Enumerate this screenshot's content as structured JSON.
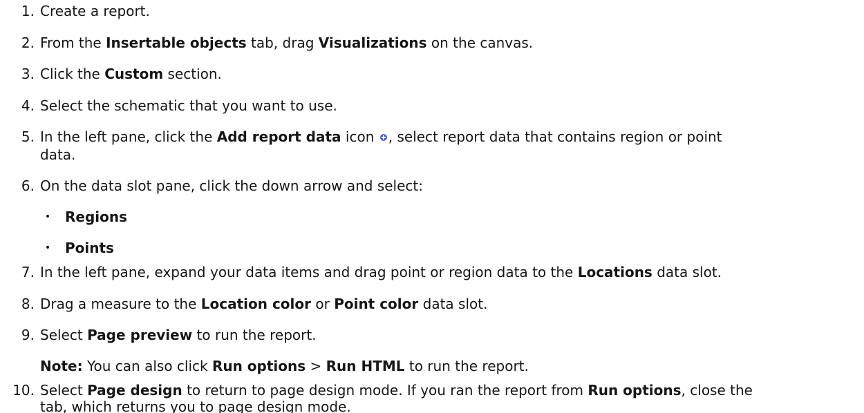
{
  "steps": {
    "s1": {
      "num": "1.",
      "text": "Create a report."
    },
    "s2": {
      "num": "2.",
      "a": "From the ",
      "b": "Insertable objects",
      "c": " tab, drag ",
      "d": "Visualizations",
      "e": " on the canvas."
    },
    "s3": {
      "num": "3.",
      "a": "Click the ",
      "b": "Custom",
      "c": " section."
    },
    "s4": {
      "num": "4.",
      "text": "Select the schematic that you want to use."
    },
    "s5": {
      "num": "5.",
      "a": "In the left pane, click the ",
      "b": "Add report data",
      "c": " icon ",
      "d": ", select report data that contains region or point",
      "line2": "data."
    },
    "s6": {
      "num": "6.",
      "text": "On the data slot pane, click the down arrow and select:",
      "bullets": [
        "Regions",
        "Points"
      ]
    },
    "s7": {
      "num": "7.",
      "a": "In the left pane, expand your data items and drag point or region data to the ",
      "b": "Locations",
      "c": " data slot."
    },
    "s8": {
      "num": "8.",
      "a": "Drag a measure to the ",
      "b": "Location color",
      "c": " or ",
      "d": "Point color",
      "e": " data slot."
    },
    "s9": {
      "num": "9.",
      "a": "Select ",
      "b": "Page preview",
      "c": " to run the report."
    },
    "note": {
      "label": "Note:",
      "a": " You can also click ",
      "b": "Run options",
      "c": " > ",
      "d": "Run HTML",
      "e": " to run the report."
    },
    "s10": {
      "num": "10.",
      "a": "Select ",
      "b": "Page design",
      "c": " to return to page design mode. If you ran the report from ",
      "d": "Run options",
      "e": ", close the",
      "line2": "tab, which returns you to page design mode."
    }
  },
  "icons": {
    "add_report_data": "add-circle-icon",
    "bullet": "bullet-dot-icon",
    "add_color": "#4a5fd6"
  }
}
